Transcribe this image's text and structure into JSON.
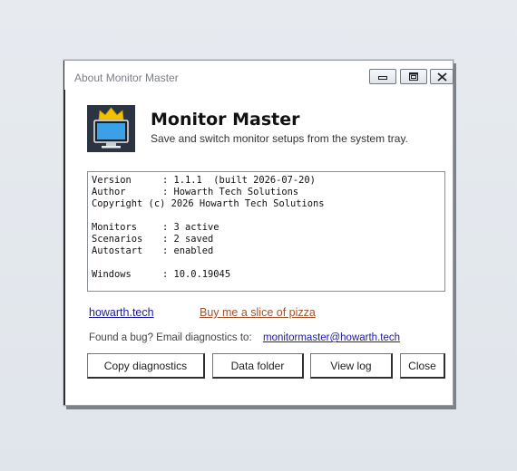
{
  "window": {
    "title": "About Monitor Master"
  },
  "titlebar_buttons": {
    "minimize_icon": "minimize-icon",
    "maximize_icon": "maximize-icon",
    "close_icon": "close-icon"
  },
  "app": {
    "name": "Monitor Master",
    "tagline": "Save and switch monitor setups from the system tray.",
    "icon": "monitor-crown-icon"
  },
  "info": {
    "version_key": "Version",
    "version_value": ": 1.1.1  (built 2026-07-20)",
    "author_key": "Author",
    "author_value": ": Howarth Tech Solutions",
    "copyright": "Copyright (c) 2026 Howarth Tech Solutions",
    "monitors_key": "Monitors",
    "monitors_value": ": 3 active",
    "scenarios_key": "Scenarios",
    "scenarios_value": ": 2 saved",
    "autostart_key": "Autostart",
    "autostart_value": ": enabled",
    "windows_key": "Windows",
    "windows_value": ": 10.0.19045"
  },
  "links": {
    "website": "howarth.tech",
    "pizza": "Buy me a slice of pizza"
  },
  "bug": {
    "text": "Found a bug? Email diagnostics to:",
    "email": "monitormaster@howarth.tech"
  },
  "buttons": {
    "copy_diagnostics": "Copy diagnostics",
    "data_folder": "Data folder",
    "view_log": "View log",
    "close": "Close"
  },
  "colors": {
    "link": "#1a1a9c",
    "pizza_link": "#a0522d",
    "icon_bg": "#2b3440",
    "crown": "#f2c200",
    "screen": "#3aa0e8"
  }
}
